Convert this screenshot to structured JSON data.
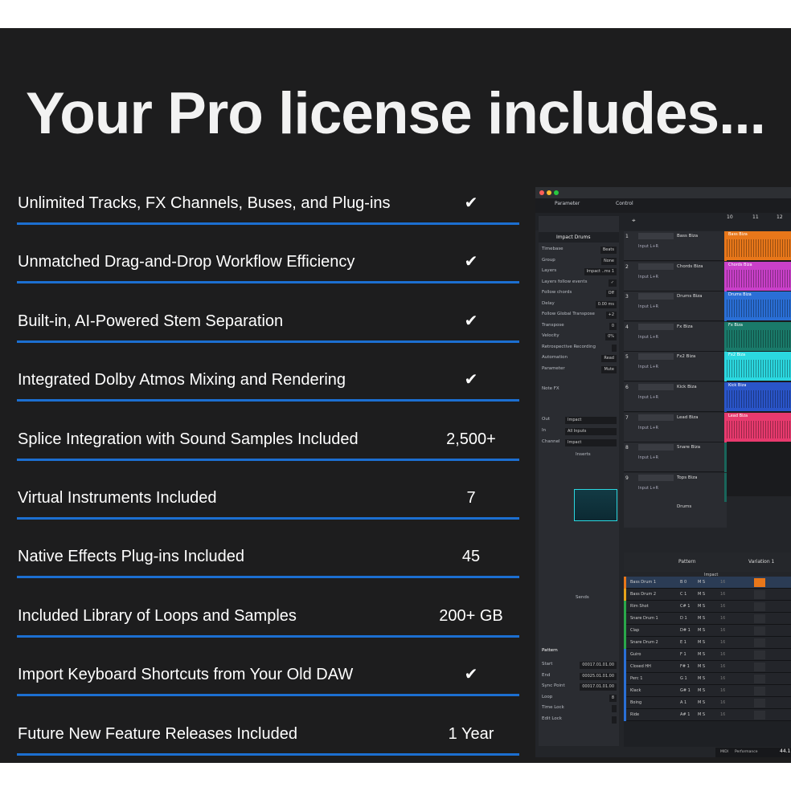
{
  "title": "Your Pro license includes...",
  "features": [
    {
      "label": "Unlimited Tracks, FX Channels, Buses, and Plug-ins",
      "value": "✔"
    },
    {
      "label": "Unmatched Drag-and-Drop Workflow Efficiency",
      "value": "✔"
    },
    {
      "label": "Built-in, AI-Powered Stem Separation",
      "value": "✔"
    },
    {
      "label": "Integrated Dolby Atmos Mixing and Rendering",
      "value": "✔"
    },
    {
      "label": "Splice Integration with Sound Samples Included",
      "value": "2,500+"
    },
    {
      "label": "Virtual Instruments Included",
      "value": "7"
    },
    {
      "label": "Native Effects Plug-ins Included",
      "value": "45"
    },
    {
      "label": "Included Library of Loops and Samples",
      "value": "200+ GB"
    },
    {
      "label": "Import Keyboard Shortcuts from Your Old DAW",
      "value": "✔"
    },
    {
      "label": "Future New Feature Releases Included",
      "value": "1 Year"
    }
  ],
  "colors": {
    "rule": "#1c6fd1",
    "panel": "#1d1d1e"
  },
  "daw": {
    "header": {
      "parameter": "Parameter",
      "control": "Control"
    },
    "inspector": {
      "track": "Impact Drums",
      "rows": [
        {
          "label": "Timebase",
          "value": "Beats"
        },
        {
          "label": "Group",
          "value": "None"
        },
        {
          "label": "Layers",
          "value": "Impact ..ms 1"
        },
        {
          "label": "Layers follow events",
          "value": "✓"
        },
        {
          "label": "Follow chords",
          "value": "Off"
        },
        {
          "label": "Delay",
          "value": "0.00 ms"
        },
        {
          "label": "Follow Global Transpose",
          "value": "+2"
        },
        {
          "label": "Transpose",
          "value": "0"
        },
        {
          "label": "Velocity",
          "value": "0%"
        },
        {
          "label": "Retrospective Recording",
          "value": ""
        },
        {
          "label": "Automation",
          "value": "Read"
        },
        {
          "label": "Parameter",
          "value": "Mute"
        }
      ],
      "note_fx": "Note FX",
      "out_label": "Out",
      "out_value": "Impact",
      "in_label": "In",
      "in_value": "All Inputs",
      "channel_label": "Channel",
      "channel_value": "Impact",
      "inserts": "Inserts",
      "sends": "Sends",
      "pattern": "Pattern",
      "pattern_rows": [
        {
          "label": "Start",
          "value": "00017.01.01.00"
        },
        {
          "label": "End",
          "value": "00025.01.01.00"
        },
        {
          "label": "Sync Point",
          "value": "00017.01.01.00"
        },
        {
          "label": "Loop",
          "value": "8"
        },
        {
          "label": "Time Lock",
          "value": ""
        },
        {
          "label": "Edit Lock",
          "value": ""
        }
      ]
    },
    "tracks": [
      {
        "num": "1",
        "name": "Bass Biza",
        "color": "#e8771a"
      },
      {
        "num": "2",
        "name": "Chords Biza",
        "color": "#c940c9"
      },
      {
        "num": "3",
        "name": "Drums Biza",
        "color": "#2a6fd6"
      },
      {
        "num": "4",
        "name": "Fx Biza",
        "color": "#1a7a6a"
      },
      {
        "num": "5",
        "name": "Fx2 Biza",
        "color": "#2bd8e0"
      },
      {
        "num": "6",
        "name": "Kick Biza",
        "color": "#2a55c9"
      },
      {
        "num": "7",
        "name": "Lead Biza",
        "color": "#e83a6e"
      },
      {
        "num": "8",
        "name": "Snare Biza",
        "color": "#19655a"
      },
      {
        "num": "9",
        "name": "Tops Biza",
        "color": "#19655a"
      }
    ],
    "input_label": "Input L+R",
    "none_label": "None",
    "drums_label": "Drums",
    "pattern_header": {
      "pattern": "Pattern",
      "variation": "Variation 1",
      "instrument": "Impact"
    },
    "pattern_rows": [
      {
        "name": "Bass Drum 1",
        "key": "B 0",
        "color": "#e8771a"
      },
      {
        "name": "Bass Drum 2",
        "key": "C 1",
        "color": "#e8a31a"
      },
      {
        "name": "Rim Shot",
        "key": "C# 1",
        "color": "#2aa84a"
      },
      {
        "name": "Snare Drum 1",
        "key": "D 1",
        "color": "#2aa84a"
      },
      {
        "name": "Clap",
        "key": "D# 1",
        "color": "#2aa84a"
      },
      {
        "name": "Snare Drum 2",
        "key": "E 1",
        "color": "#2aa84a"
      },
      {
        "name": "Guiro",
        "key": "F 1",
        "color": "#2a6fd6"
      },
      {
        "name": "Closed HH",
        "key": "F# 1",
        "color": "#2a6fd6"
      },
      {
        "name": "Perc 1",
        "key": "G 1",
        "color": "#2a6fd6"
      },
      {
        "name": "Klack",
        "key": "G# 1",
        "color": "#2a6fd6"
      },
      {
        "name": "Boing",
        "key": "A 1",
        "color": "#2a6fd6"
      },
      {
        "name": "Ride",
        "key": "A# 1",
        "color": "#2a6fd6"
      }
    ],
    "step_values": {
      "m": "M",
      "s": "S",
      "count": "16",
      "div": "1/16"
    },
    "ruler": [
      "10",
      "11",
      "12"
    ],
    "status": {
      "midi": "MIDI",
      "performance": "Performance",
      "rate": "44.1",
      "sub": "7.1 s"
    }
  }
}
